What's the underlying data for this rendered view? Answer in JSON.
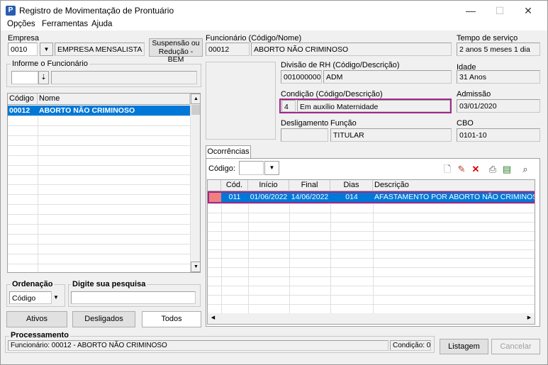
{
  "window": {
    "title": "Registro de Movimentação de Prontuário",
    "minimize": "—",
    "maximize": "☐",
    "close": "✕"
  },
  "menu": [
    "Opções",
    "Ferramentas",
    "Ajuda"
  ],
  "empresa": {
    "label": "Empresa",
    "code": "0010",
    "name": "EMPRESA MENSALISTA",
    "suspensao_button": "Suspensão ou Redução - BEM"
  },
  "informe": {
    "label": "Informe o Funcionário",
    "value": "",
    "name": ""
  },
  "employee_grid": {
    "headers": [
      "Código",
      "Nome"
    ],
    "rows": [
      {
        "codigo": "00012",
        "nome": "ABORTO NÃO CRIMINOSO"
      }
    ]
  },
  "ordenacao": {
    "label": "Ordenação",
    "selected": "Código"
  },
  "pesquisa": {
    "label": "Digite sua pesquisa",
    "value": ""
  },
  "filter_buttons": {
    "ativos": "Ativos",
    "desligados": "Desligados",
    "todos": "Todos"
  },
  "funcionario": {
    "label": "Funcionário (Código/Nome)",
    "code": "00012",
    "name": "ABORTO NÃO CRIMINOSO"
  },
  "tempo_servico": {
    "label": "Tempo de serviço",
    "value": "2 anos 5 meses 1 dia"
  },
  "divisao": {
    "label": "Divisão de RH (Código/Descrição)",
    "code": "001000000",
    "desc": "ADM"
  },
  "idade": {
    "label": "Idade",
    "value": "31 Anos"
  },
  "condicao": {
    "label": "Condição (Código/Descrição)",
    "code": "4",
    "desc": "Em auxílio Maternidade"
  },
  "admissao": {
    "label": "Admissão",
    "value": "03/01/2020"
  },
  "desligamento": {
    "label": "Desligamento",
    "value": ""
  },
  "funcao": {
    "label": "Função",
    "value": "TITULAR"
  },
  "cbo": {
    "label": "CBO",
    "value": "0101-10"
  },
  "ocorrencias": {
    "tab_label": "Ocorrências",
    "codigo_label": "Código:",
    "codigo_value": "",
    "headers": [
      "Cód.",
      "Início",
      "Final",
      "Dias",
      "Descrição"
    ],
    "rows": [
      {
        "cod": "011",
        "inicio": "01/06/2022",
        "final": "14/06/2022",
        "dias": "014",
        "descricao": "AFASTAMENTO POR ABORTO NÃO CRIMINOSO"
      }
    ]
  },
  "processamento": {
    "label": "Processamento",
    "status": "Funcionário: 00012 - ABORTO NÃO CRIMINOSO",
    "condicao": "Condição: 0"
  },
  "bottom_buttons": {
    "listagem": "Listagem",
    "cancelar": "Cancelar"
  },
  "colors": {
    "selection": "#0078d7",
    "condicao_border": "#a0288c",
    "row_marker": "#f08080"
  }
}
